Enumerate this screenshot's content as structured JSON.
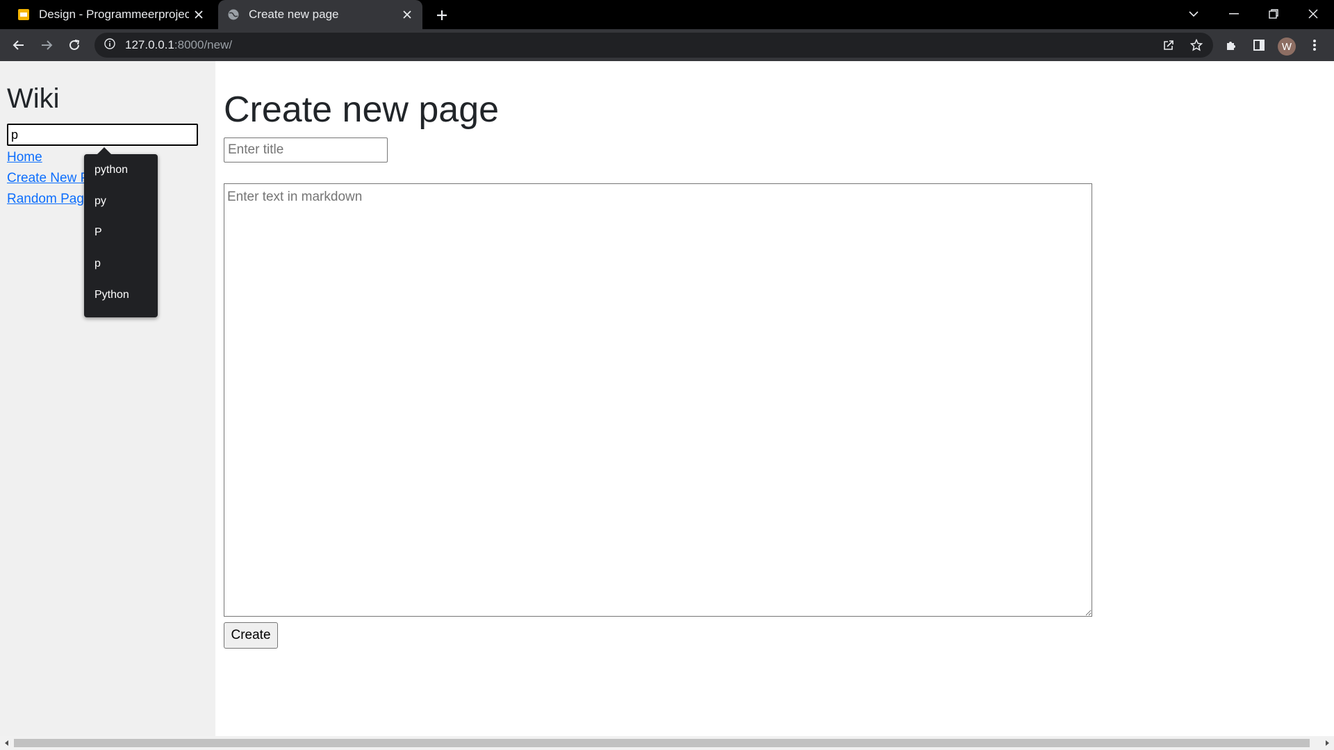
{
  "browser": {
    "tabs": [
      {
        "title": "Design - Programmeerproject",
        "active": false,
        "icon": "google-slides-icon"
      },
      {
        "title": "Create new page",
        "active": true,
        "icon": "globe-icon"
      }
    ],
    "url": {
      "host": "127.0.0.1",
      "path": ":8000/new/"
    },
    "profile_initial": "W"
  },
  "sidebar": {
    "title": "Wiki",
    "search": {
      "value": "p",
      "placeholder": ""
    },
    "links": [
      {
        "label": "Home"
      },
      {
        "label": "Create New Page"
      },
      {
        "label": "Random Page"
      }
    ]
  },
  "autocomplete": {
    "items": [
      "python",
      "py",
      "P",
      "p",
      "Python"
    ]
  },
  "main": {
    "heading": "Create new page",
    "title_placeholder": "Enter title",
    "content_placeholder": "Enter text in markdown",
    "submit_label": "Create"
  },
  "colors": {
    "tabstrip": "#000000",
    "toolbar": "#35363a",
    "sidebar": "#f0f0f0",
    "link": "#0d6efd",
    "dropdown": "#202124"
  }
}
